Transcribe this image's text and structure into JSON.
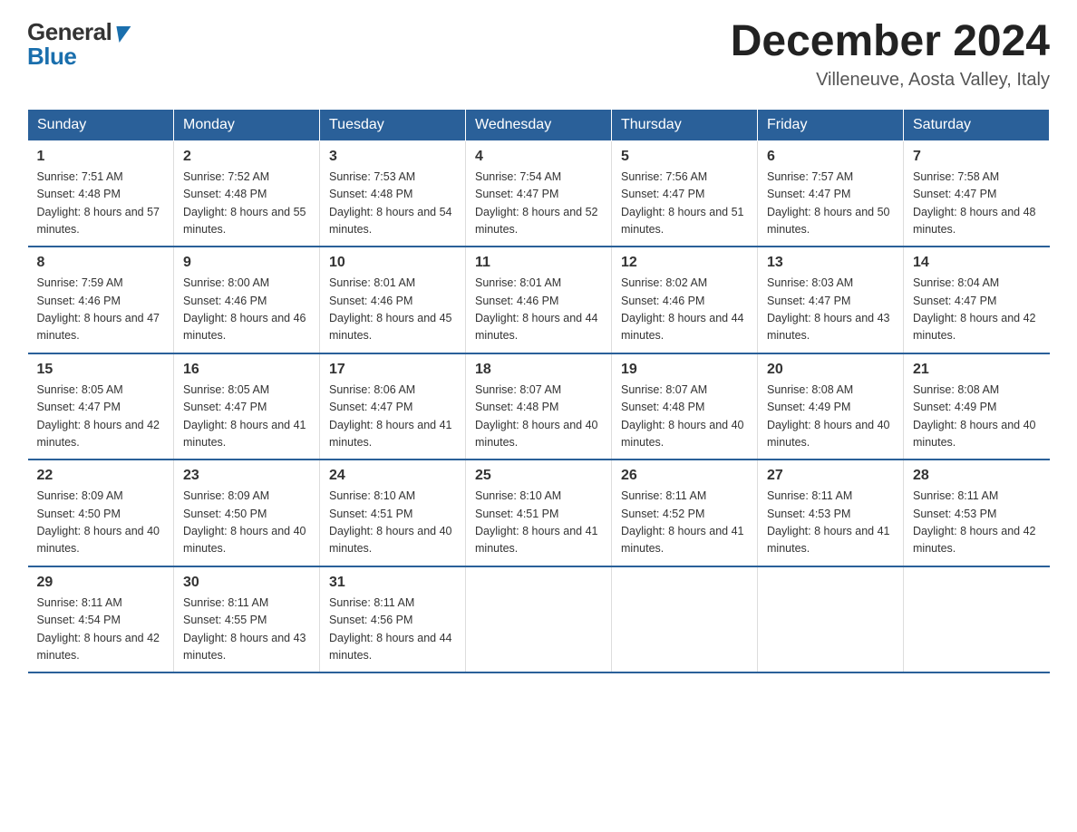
{
  "header": {
    "logo_general": "General",
    "logo_blue": "Blue",
    "month_title": "December 2024",
    "location": "Villeneuve, Aosta Valley, Italy"
  },
  "days_of_week": [
    "Sunday",
    "Monday",
    "Tuesday",
    "Wednesday",
    "Thursday",
    "Friday",
    "Saturday"
  ],
  "weeks": [
    [
      {
        "day": "1",
        "sunrise": "7:51 AM",
        "sunset": "4:48 PM",
        "daylight": "8 hours and 57 minutes."
      },
      {
        "day": "2",
        "sunrise": "7:52 AM",
        "sunset": "4:48 PM",
        "daylight": "8 hours and 55 minutes."
      },
      {
        "day": "3",
        "sunrise": "7:53 AM",
        "sunset": "4:48 PM",
        "daylight": "8 hours and 54 minutes."
      },
      {
        "day": "4",
        "sunrise": "7:54 AM",
        "sunset": "4:47 PM",
        "daylight": "8 hours and 52 minutes."
      },
      {
        "day": "5",
        "sunrise": "7:56 AM",
        "sunset": "4:47 PM",
        "daylight": "8 hours and 51 minutes."
      },
      {
        "day": "6",
        "sunrise": "7:57 AM",
        "sunset": "4:47 PM",
        "daylight": "8 hours and 50 minutes."
      },
      {
        "day": "7",
        "sunrise": "7:58 AM",
        "sunset": "4:47 PM",
        "daylight": "8 hours and 48 minutes."
      }
    ],
    [
      {
        "day": "8",
        "sunrise": "7:59 AM",
        "sunset": "4:46 PM",
        "daylight": "8 hours and 47 minutes."
      },
      {
        "day": "9",
        "sunrise": "8:00 AM",
        "sunset": "4:46 PM",
        "daylight": "8 hours and 46 minutes."
      },
      {
        "day": "10",
        "sunrise": "8:01 AM",
        "sunset": "4:46 PM",
        "daylight": "8 hours and 45 minutes."
      },
      {
        "day": "11",
        "sunrise": "8:01 AM",
        "sunset": "4:46 PM",
        "daylight": "8 hours and 44 minutes."
      },
      {
        "day": "12",
        "sunrise": "8:02 AM",
        "sunset": "4:46 PM",
        "daylight": "8 hours and 44 minutes."
      },
      {
        "day": "13",
        "sunrise": "8:03 AM",
        "sunset": "4:47 PM",
        "daylight": "8 hours and 43 minutes."
      },
      {
        "day": "14",
        "sunrise": "8:04 AM",
        "sunset": "4:47 PM",
        "daylight": "8 hours and 42 minutes."
      }
    ],
    [
      {
        "day": "15",
        "sunrise": "8:05 AM",
        "sunset": "4:47 PM",
        "daylight": "8 hours and 42 minutes."
      },
      {
        "day": "16",
        "sunrise": "8:05 AM",
        "sunset": "4:47 PM",
        "daylight": "8 hours and 41 minutes."
      },
      {
        "day": "17",
        "sunrise": "8:06 AM",
        "sunset": "4:47 PM",
        "daylight": "8 hours and 41 minutes."
      },
      {
        "day": "18",
        "sunrise": "8:07 AM",
        "sunset": "4:48 PM",
        "daylight": "8 hours and 40 minutes."
      },
      {
        "day": "19",
        "sunrise": "8:07 AM",
        "sunset": "4:48 PM",
        "daylight": "8 hours and 40 minutes."
      },
      {
        "day": "20",
        "sunrise": "8:08 AM",
        "sunset": "4:49 PM",
        "daylight": "8 hours and 40 minutes."
      },
      {
        "day": "21",
        "sunrise": "8:08 AM",
        "sunset": "4:49 PM",
        "daylight": "8 hours and 40 minutes."
      }
    ],
    [
      {
        "day": "22",
        "sunrise": "8:09 AM",
        "sunset": "4:50 PM",
        "daylight": "8 hours and 40 minutes."
      },
      {
        "day": "23",
        "sunrise": "8:09 AM",
        "sunset": "4:50 PM",
        "daylight": "8 hours and 40 minutes."
      },
      {
        "day": "24",
        "sunrise": "8:10 AM",
        "sunset": "4:51 PM",
        "daylight": "8 hours and 40 minutes."
      },
      {
        "day": "25",
        "sunrise": "8:10 AM",
        "sunset": "4:51 PM",
        "daylight": "8 hours and 41 minutes."
      },
      {
        "day": "26",
        "sunrise": "8:11 AM",
        "sunset": "4:52 PM",
        "daylight": "8 hours and 41 minutes."
      },
      {
        "day": "27",
        "sunrise": "8:11 AM",
        "sunset": "4:53 PM",
        "daylight": "8 hours and 41 minutes."
      },
      {
        "day": "28",
        "sunrise": "8:11 AM",
        "sunset": "4:53 PM",
        "daylight": "8 hours and 42 minutes."
      }
    ],
    [
      {
        "day": "29",
        "sunrise": "8:11 AM",
        "sunset": "4:54 PM",
        "daylight": "8 hours and 42 minutes."
      },
      {
        "day": "30",
        "sunrise": "8:11 AM",
        "sunset": "4:55 PM",
        "daylight": "8 hours and 43 minutes."
      },
      {
        "day": "31",
        "sunrise": "8:11 AM",
        "sunset": "4:56 PM",
        "daylight": "8 hours and 44 minutes."
      },
      null,
      null,
      null,
      null
    ]
  ]
}
